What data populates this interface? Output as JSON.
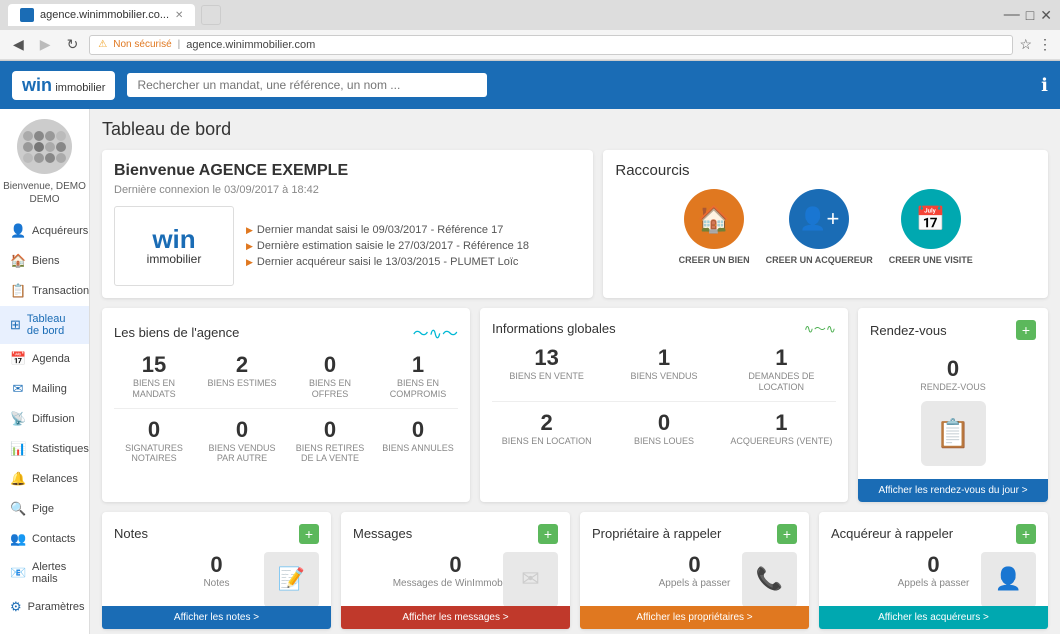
{
  "browser": {
    "tab_title": "agence.winimmobilier.co...",
    "url": "agence.winimmobilier.com",
    "url_label": "Non sécurisé"
  },
  "header": {
    "logo_win": "win",
    "logo_immo": "immobilier",
    "search_placeholder": "Rechercher un mandat, une référence, un nom ...",
    "info_icon": "ℹ"
  },
  "sidebar": {
    "avatar_label": "Bienvenue, DEMO DEMO",
    "items": [
      {
        "label": "Acquéreurs",
        "icon": "👤"
      },
      {
        "label": "Biens",
        "icon": "🏠"
      },
      {
        "label": "Transactions",
        "icon": "📋"
      },
      {
        "label": "Tableau de bord",
        "icon": "⊞"
      },
      {
        "label": "Agenda",
        "icon": "📅"
      },
      {
        "label": "Mailing",
        "icon": "✉"
      },
      {
        "label": "Diffusion",
        "icon": "📡"
      },
      {
        "label": "Statistiques",
        "icon": "📊"
      },
      {
        "label": "Relances",
        "icon": "🔔"
      },
      {
        "label": "Pige",
        "icon": "🔍"
      },
      {
        "label": "Contacts",
        "icon": "👥"
      },
      {
        "label": "Alertes mails",
        "icon": "📧"
      },
      {
        "label": "Paramètres",
        "icon": "⚙"
      }
    ]
  },
  "page": {
    "title": "Tableau de bord"
  },
  "welcome": {
    "title": "Bienvenue AGENCE EXEMPLE",
    "last_login": "Dernière connexion le 03/09/2017 à 18:42",
    "links": [
      "Dernier mandat saisi le 09/03/2017 - Référence 17",
      "Dernière estimation saisie le 27/03/2017 - Référence 18",
      "Dernier acquéreur saisi le 13/03/2015 - PLUMET Loïc"
    ]
  },
  "shortcuts": {
    "title": "Raccourcis",
    "items": [
      {
        "label": "CREER UN BIEN",
        "color": "sc-orange",
        "icon": "🏠"
      },
      {
        "label": "CREER UN ACQUEREUR",
        "color": "sc-blue",
        "icon": "👤"
      },
      {
        "label": "CREER UNE VISITE",
        "color": "sc-teal",
        "icon": "📅"
      }
    ]
  },
  "biens": {
    "title": "Les biens de l'agence",
    "stats_row1": [
      {
        "num": "15",
        "label": "BIENS EN MANDATS"
      },
      {
        "num": "2",
        "label": "BIENS ESTIMES"
      },
      {
        "num": "0",
        "label": "BIENS EN OFFRES"
      },
      {
        "num": "1",
        "label": "BIENS EN COMPROMIS"
      }
    ],
    "stats_row2": [
      {
        "num": "0",
        "label": "SIGNATURES NOTAIRES"
      },
      {
        "num": "0",
        "label": "BIENS VENDUS PAR AUTRE"
      },
      {
        "num": "0",
        "label": "BIENS RETIRES DE LA VENTE"
      },
      {
        "num": "0",
        "label": "BIENS ANNULES"
      }
    ]
  },
  "infos": {
    "title": "Informations globales",
    "stats_row1": [
      {
        "num": "13",
        "label": "BIENS EN VENTE"
      },
      {
        "num": "1",
        "label": "BIENS VENDUS"
      },
      {
        "num": "1",
        "label": "DEMANDES DE LOCATION"
      }
    ],
    "stats_row2": [
      {
        "num": "2",
        "label": "BIENS EN LOCATION"
      },
      {
        "num": "0",
        "label": "BIENS LOUES"
      },
      {
        "num": "1",
        "label": "ACQUEREURS (VENTE)"
      }
    ]
  },
  "rdv": {
    "title": "Rendez-vous",
    "num": "0",
    "label": "Rendez-vous",
    "action": "Afficher les rendez-vous du jour >"
  },
  "notes": {
    "title": "Notes",
    "num": "0",
    "label": "Notes",
    "action": "Afficher les notes >"
  },
  "messages": {
    "title": "Messages",
    "num": "0",
    "label": "Messages de WinImmobilier",
    "action": "Afficher les messages >"
  },
  "proprietaires": {
    "title": "Propriétaire à rappeler",
    "num": "0",
    "label": "Appels à passer",
    "action": "Afficher les propriétaires >"
  },
  "acquereurs": {
    "title": "Acquéreur à rappeler",
    "num": "0",
    "label": "Appels à passer",
    "action": "Afficher les acquéreurs >"
  }
}
